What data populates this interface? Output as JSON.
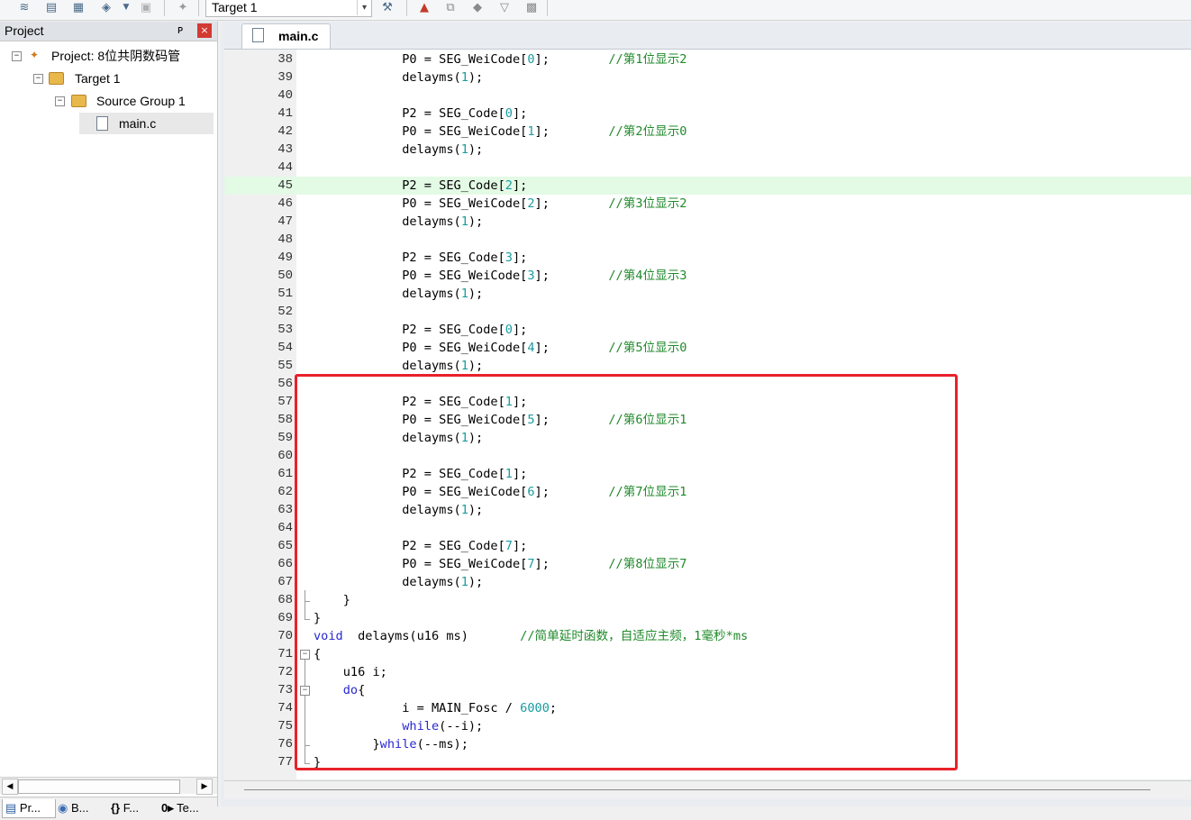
{
  "toolbar": {
    "icons": [
      "stack-icon",
      "save-all-icon",
      "grid-icon",
      "layers-icon",
      "dropdown-arrow-icon",
      "options-icon",
      "download-icon",
      "target-options-icon",
      "manage-icon",
      "components-icon",
      "diamond-icon",
      "filter-icon",
      "grid2-icon"
    ],
    "target": "Target 1"
  },
  "project_panel": {
    "title": "Project",
    "pin": "ᴘ",
    "close": "×",
    "tree": [
      {
        "label": "Project: 8位共阴数码管",
        "icon": "project-icon"
      },
      {
        "label": "Target 1",
        "icon": "target-icon"
      },
      {
        "label": "Source Group 1",
        "icon": "folder-icon"
      },
      {
        "label": "main.c",
        "icon": "file-icon"
      }
    ],
    "bottom_tabs": [
      {
        "icon": "▤",
        "label": "Pr..."
      },
      {
        "icon": "◉",
        "label": "B..."
      },
      {
        "icon": "{}",
        "label": "F..."
      },
      {
        "icon": "0▸",
        "label": "Te..."
      }
    ]
  },
  "editor": {
    "tab_label": "main.c",
    "lines": [
      {
        "n": "38",
        "text": "            P0 = SEG_WeiCode[0];        //第1位显示2"
      },
      {
        "n": "39",
        "text": "            delayms(1);"
      },
      {
        "n": "40",
        "text": ""
      },
      {
        "n": "41",
        "text": "            P2 = SEG_Code[0];"
      },
      {
        "n": "42",
        "text": "            P0 = SEG_WeiCode[1];        //第2位显示0"
      },
      {
        "n": "43",
        "text": "            delayms(1);"
      },
      {
        "n": "44",
        "text": ""
      },
      {
        "n": "45",
        "text": "            P2 = SEG_Code[2];"
      },
      {
        "n": "46",
        "text": "            P0 = SEG_WeiCode[2];        //第3位显示2"
      },
      {
        "n": "47",
        "text": "            delayms(1);"
      },
      {
        "n": "48",
        "text": ""
      },
      {
        "n": "49",
        "text": "            P2 = SEG_Code[3];"
      },
      {
        "n": "50",
        "text": "            P0 = SEG_WeiCode[3];        //第4位显示3"
      },
      {
        "n": "51",
        "text": "            delayms(1);"
      },
      {
        "n": "52",
        "text": ""
      },
      {
        "n": "53",
        "text": "            P2 = SEG_Code[0];"
      },
      {
        "n": "54",
        "text": "            P0 = SEG_WeiCode[4];        //第5位显示0"
      },
      {
        "n": "55",
        "text": "            delayms(1);"
      },
      {
        "n": "56",
        "text": ""
      },
      {
        "n": "57",
        "text": "            P2 = SEG_Code[1];"
      },
      {
        "n": "58",
        "text": "            P0 = SEG_WeiCode[5];        //第6位显示1"
      },
      {
        "n": "59",
        "text": "            delayms(1);"
      },
      {
        "n": "60",
        "text": ""
      },
      {
        "n": "61",
        "text": "            P2 = SEG_Code[1];"
      },
      {
        "n": "62",
        "text": "            P0 = SEG_WeiCode[6];        //第7位显示1"
      },
      {
        "n": "63",
        "text": "            delayms(1);"
      },
      {
        "n": "64",
        "text": ""
      },
      {
        "n": "65",
        "text": "            P2 = SEG_Code[7];"
      },
      {
        "n": "66",
        "text": "            P0 = SEG_WeiCode[7];        //第8位显示7"
      },
      {
        "n": "67",
        "text": "            delayms(1);"
      },
      {
        "n": "68",
        "text": "    }"
      },
      {
        "n": "69",
        "text": "}"
      },
      {
        "n": "70",
        "text": "void  delayms(u16 ms)       //简单延时函数，自适应主频，1毫秒*ms"
      },
      {
        "n": "71",
        "text": "{"
      },
      {
        "n": "72",
        "text": "    u16 i;"
      },
      {
        "n": "73",
        "text": "    do{"
      },
      {
        "n": "74",
        "text": "            i = MAIN_Fosc / 6000;"
      },
      {
        "n": "75",
        "text": "            while(--i);"
      },
      {
        "n": "76",
        "text": "        }while(--ms);"
      },
      {
        "n": "77",
        "text": "}"
      }
    ],
    "highlighted_line": "45"
  },
  "colors": {
    "keyword": "#2828d2",
    "number": "#1a9ba1",
    "comment": "#1f8a2a",
    "current_line": "#e3fae5",
    "annotation_box": "#e8212a"
  }
}
